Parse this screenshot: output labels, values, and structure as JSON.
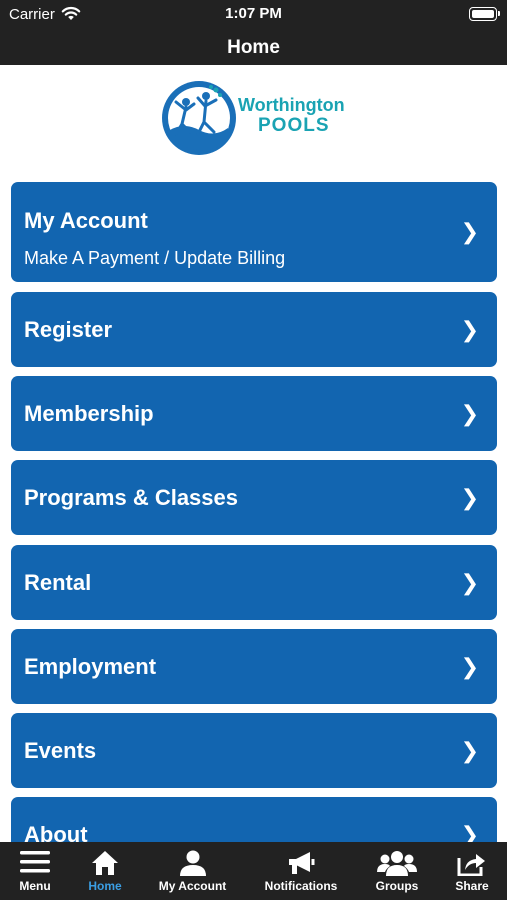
{
  "status_bar": {
    "carrier": "Carrier",
    "time": "1:07 PM"
  },
  "nav": {
    "title": "Home"
  },
  "logo": {
    "line1": "Worthington",
    "line2": "POOLS"
  },
  "menu": {
    "items": [
      {
        "label": "My Account",
        "sub": "Make A Payment / Update Billing"
      },
      {
        "label": "Register"
      },
      {
        "label": "Membership"
      },
      {
        "label": "Programs & Classes"
      },
      {
        "label": "Rental"
      },
      {
        "label": "Employment"
      },
      {
        "label": "Events"
      },
      {
        "label": "About"
      }
    ],
    "chevron": "❯"
  },
  "tabs": [
    {
      "label": "Menu",
      "icon": "hamburger-icon"
    },
    {
      "label": "Home",
      "icon": "home-icon",
      "active": true
    },
    {
      "label": "My Account",
      "icon": "person-icon"
    },
    {
      "label": "Notifications",
      "icon": "megaphone-icon"
    },
    {
      "label": "Groups",
      "icon": "group-icon"
    },
    {
      "label": "Share",
      "icon": "share-icon"
    }
  ],
  "colors": {
    "bar": "#222222",
    "tile": "#1265b0",
    "active_tab": "#3b9ee3",
    "brand": "#1aa3b3"
  }
}
